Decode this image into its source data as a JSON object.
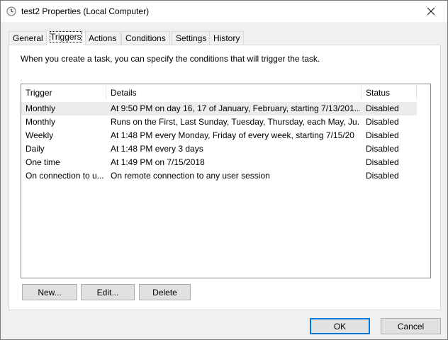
{
  "window": {
    "title": "test2 Properties (Local Computer)",
    "icon": "clock-icon",
    "close": "×"
  },
  "tabs": [
    {
      "label": "General",
      "active": false
    },
    {
      "label": "Triggers",
      "active": true
    },
    {
      "label": "Actions",
      "active": false
    },
    {
      "label": "Conditions",
      "active": false
    },
    {
      "label": "Settings",
      "active": false
    },
    {
      "label": "History",
      "active": false
    }
  ],
  "panel": {
    "intro": "When you create a task, you can specify the conditions that will trigger the task."
  },
  "table": {
    "columns": [
      "Trigger",
      "Details",
      "Status"
    ],
    "rows": [
      {
        "trigger": "Monthly",
        "details": "At 9:50 PM  on day 16, 17 of January, February, starting 7/13/201...",
        "status": "Disabled",
        "selected": true
      },
      {
        "trigger": "Monthly",
        "details": "Runs on the First, Last Sunday, Tuesday, Thursday, each May, Ju...",
        "status": "Disabled",
        "selected": false
      },
      {
        "trigger": "Weekly",
        "details": "At 1:48 PM every Monday, Friday of every week, starting 7/15/20",
        "status": "Disabled",
        "selected": false
      },
      {
        "trigger": "Daily",
        "details": "At 1:48 PM every 3 days",
        "status": "Disabled",
        "selected": false
      },
      {
        "trigger": "One time",
        "details": "At 1:49 PM on 7/15/2018",
        "status": "Disabled",
        "selected": false
      },
      {
        "trigger": "On connection to u...",
        "details": "On remote connection to any user session",
        "status": "Disabled",
        "selected": false
      }
    ]
  },
  "buttons": {
    "new": "New...",
    "edit": "Edit...",
    "delete": "Delete",
    "ok": "OK",
    "cancel": "Cancel"
  },
  "colors": {
    "selected_row": "#ececec",
    "default_button_border": "#0078d7"
  }
}
